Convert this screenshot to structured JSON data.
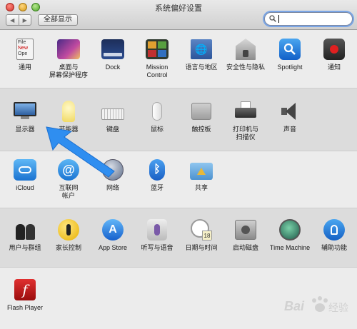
{
  "window": {
    "title": "系统偏好设置"
  },
  "toolbar": {
    "back_glyph": "◀",
    "forward_glyph": "▶",
    "show_all_label": "全部显示",
    "search_value": ""
  },
  "rows": [
    [
      {
        "label": "通用",
        "icon": "general-icon"
      },
      {
        "label": "桌面与\n屏幕保护程序",
        "icon": "desktop-screensaver-icon"
      },
      {
        "label": "Dock",
        "icon": "dock-icon"
      },
      {
        "label": "Mission\nControl",
        "icon": "mission-control-icon"
      },
      {
        "label": "语言与地区",
        "icon": "language-region-icon"
      },
      {
        "label": "安全性与隐私",
        "icon": "security-privacy-icon"
      },
      {
        "label": "Spotlight",
        "icon": "spotlight-icon"
      },
      {
        "label": "通知",
        "icon": "notifications-icon"
      }
    ],
    [
      {
        "label": "显示器",
        "icon": "displays-icon"
      },
      {
        "label": "节能器",
        "icon": "energy-saver-icon"
      },
      {
        "label": "键盘",
        "icon": "keyboard-icon"
      },
      {
        "label": "鼠标",
        "icon": "mouse-icon"
      },
      {
        "label": "触控板",
        "icon": "trackpad-icon"
      },
      {
        "label": "打印机与\n扫描仪",
        "icon": "printers-scanners-icon"
      },
      {
        "label": "声音",
        "icon": "sound-icon"
      }
    ],
    [
      {
        "label": "iCloud",
        "icon": "icloud-icon"
      },
      {
        "label": "互联网\n帐户",
        "icon": "internet-accounts-icon"
      },
      {
        "label": "网络",
        "icon": "network-icon"
      },
      {
        "label": "蓝牙",
        "icon": "bluetooth-icon"
      },
      {
        "label": "共享",
        "icon": "sharing-icon"
      }
    ],
    [
      {
        "label": "用户与群组",
        "icon": "users-groups-icon"
      },
      {
        "label": "家长控制",
        "icon": "parental-controls-icon"
      },
      {
        "label": "App Store",
        "icon": "app-store-icon"
      },
      {
        "label": "听写与语音",
        "icon": "dictation-speech-icon"
      },
      {
        "label": "日期与时间",
        "icon": "date-time-icon"
      },
      {
        "label": "启动磁盘",
        "icon": "startup-disk-icon"
      },
      {
        "label": "Time Machine",
        "icon": "time-machine-icon"
      },
      {
        "label": "辅助功能",
        "icon": "accessibility-icon"
      }
    ],
    [
      {
        "label": "Flash Player",
        "icon": "flash-player-icon"
      }
    ]
  ],
  "annotation": {
    "arrow_color": "#2f8ef0",
    "arrow_target": "显示器"
  },
  "watermark": {
    "text": "Bai 经验",
    "icon": "baidu-paw-icon"
  }
}
